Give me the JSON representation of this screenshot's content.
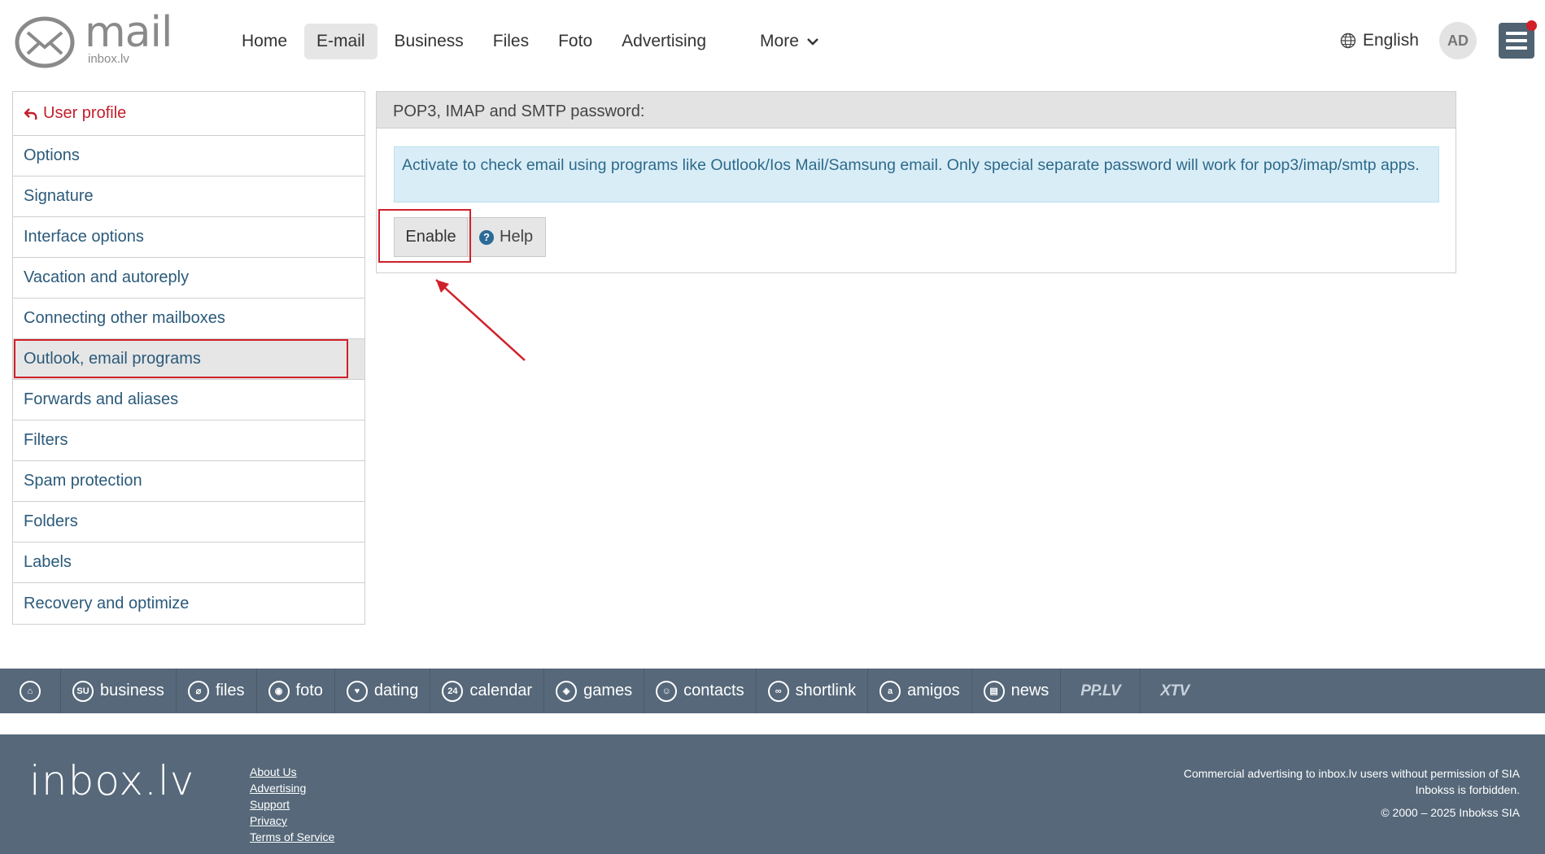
{
  "header": {
    "logo_word": "mail",
    "logo_sub": "inbox.lv",
    "nav": [
      {
        "label": "Home",
        "name": "nav-home"
      },
      {
        "label": "E-mail",
        "name": "nav-email",
        "active": true
      },
      {
        "label": "Business",
        "name": "nav-business"
      },
      {
        "label": "Files",
        "name": "nav-files"
      },
      {
        "label": "Foto",
        "name": "nav-foto"
      },
      {
        "label": "Advertising",
        "name": "nav-advertising"
      }
    ],
    "more_label": "More",
    "language": "English",
    "avatar_initials": "AD"
  },
  "sidebar": {
    "back_label": "User profile",
    "items": [
      "Options",
      "Signature",
      "Interface options",
      "Vacation and autoreply",
      "Connecting other mailboxes",
      "Outlook, email programs",
      "Forwards and aliases",
      "Filters",
      "Spam protection",
      "Folders",
      "Labels",
      "Recovery and optimize"
    ],
    "active_index": 5
  },
  "panel": {
    "title": "POP3, IMAP and SMTP password:",
    "info": "Activate to check email using programs like Outlook/Ios Mail/Samsung email. Only special separate password will work for pop3/imap/smtp apps.",
    "enable_label": "Enable",
    "help_label": "Help"
  },
  "services": [
    {
      "label": "business",
      "icon": "SU"
    },
    {
      "label": "files",
      "icon": "⌀"
    },
    {
      "label": "foto",
      "icon": "◉"
    },
    {
      "label": "dating",
      "icon": "♥"
    },
    {
      "label": "calendar",
      "icon": "24"
    },
    {
      "label": "games",
      "icon": "◈"
    },
    {
      "label": "contacts",
      "icon": "☺"
    },
    {
      "label": "shortlink",
      "icon": "∞"
    },
    {
      "label": "amigos",
      "icon": "a"
    },
    {
      "label": "news",
      "icon": "▤"
    }
  ],
  "service_brands": [
    "PP.LV",
    "XTV"
  ],
  "footer": {
    "logo": "inbox.lv",
    "links": [
      "About Us",
      "Advertising",
      "Support",
      "Privacy",
      "Terms of Service"
    ],
    "notice": "Commercial advertising to inbox.lv users without permission of SIA Inbokss is forbidden.",
    "copyright": "© 2000 – 2025 Inbokss SIA"
  },
  "colors": {
    "accent_red": "#d0202a",
    "link_blue": "#2b5a7a",
    "footer_bg": "#56687a",
    "info_bg": "#d9edf7"
  }
}
